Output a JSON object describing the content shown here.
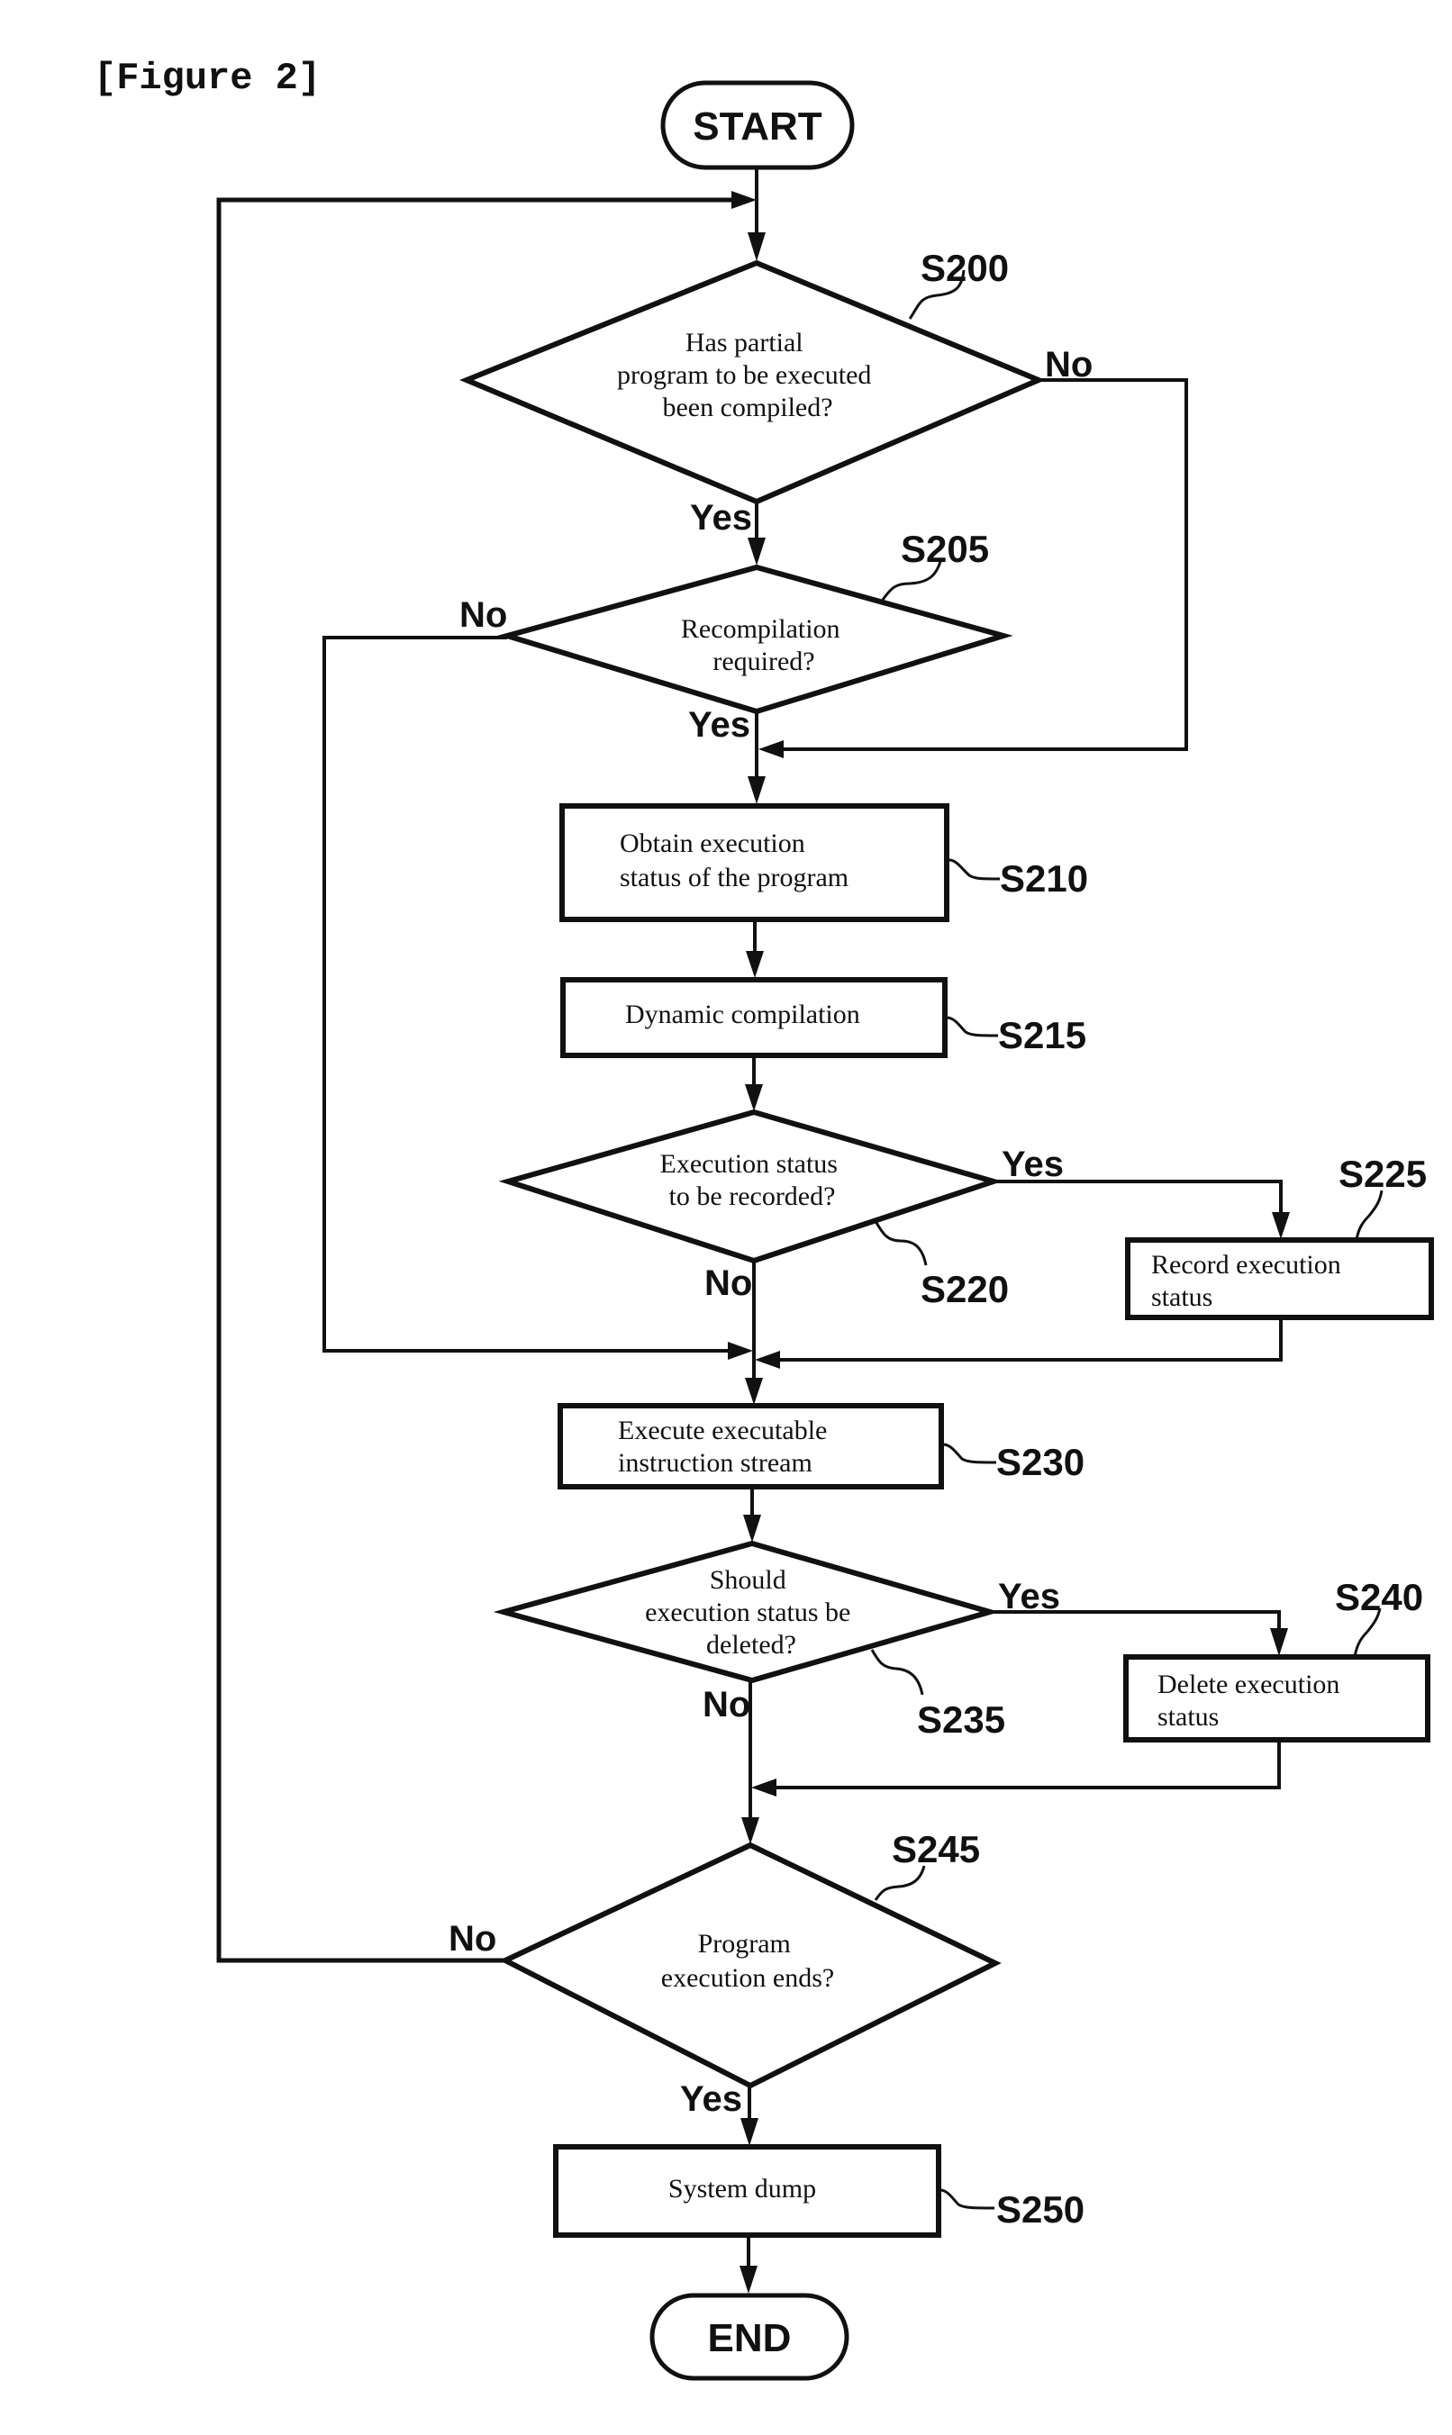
{
  "figure": {
    "title": "[Figure 2]"
  },
  "terminals": {
    "start": "START",
    "end": "END"
  },
  "steps": {
    "s200": {
      "id": "S200",
      "type": "decision",
      "lines": [
        "Has partial",
        "program to be executed",
        "been compiled?"
      ],
      "yes": "Yes",
      "no": "No"
    },
    "s205": {
      "id": "S205",
      "type": "decision",
      "lines": [
        "Recompilation",
        "required?"
      ],
      "yes": "Yes",
      "no": "No"
    },
    "s210": {
      "id": "S210",
      "type": "process",
      "lines": [
        "Obtain execution",
        "status of the program"
      ]
    },
    "s215": {
      "id": "S215",
      "type": "process",
      "lines": [
        "Dynamic compilation"
      ]
    },
    "s220": {
      "id": "S220",
      "type": "decision",
      "lines": [
        "Execution status",
        "to be recorded?"
      ],
      "yes": "Yes",
      "no": "No"
    },
    "s225": {
      "id": "S225",
      "type": "process",
      "lines": [
        "Record execution",
        "status"
      ]
    },
    "s230": {
      "id": "S230",
      "type": "process",
      "lines": [
        "Execute executable",
        "instruction stream"
      ]
    },
    "s235": {
      "id": "S235",
      "type": "decision",
      "lines": [
        "Should",
        "execution status be",
        "deleted?"
      ],
      "yes": "Yes",
      "no": "No"
    },
    "s240": {
      "id": "S240",
      "type": "process",
      "lines": [
        "Delete execution",
        "status"
      ]
    },
    "s245": {
      "id": "S245",
      "type": "decision",
      "lines": [
        "Program",
        "execution ends?"
      ],
      "yes": "Yes",
      "no": "No"
    },
    "s250": {
      "id": "S250",
      "type": "process",
      "lines": [
        "System dump"
      ]
    }
  }
}
